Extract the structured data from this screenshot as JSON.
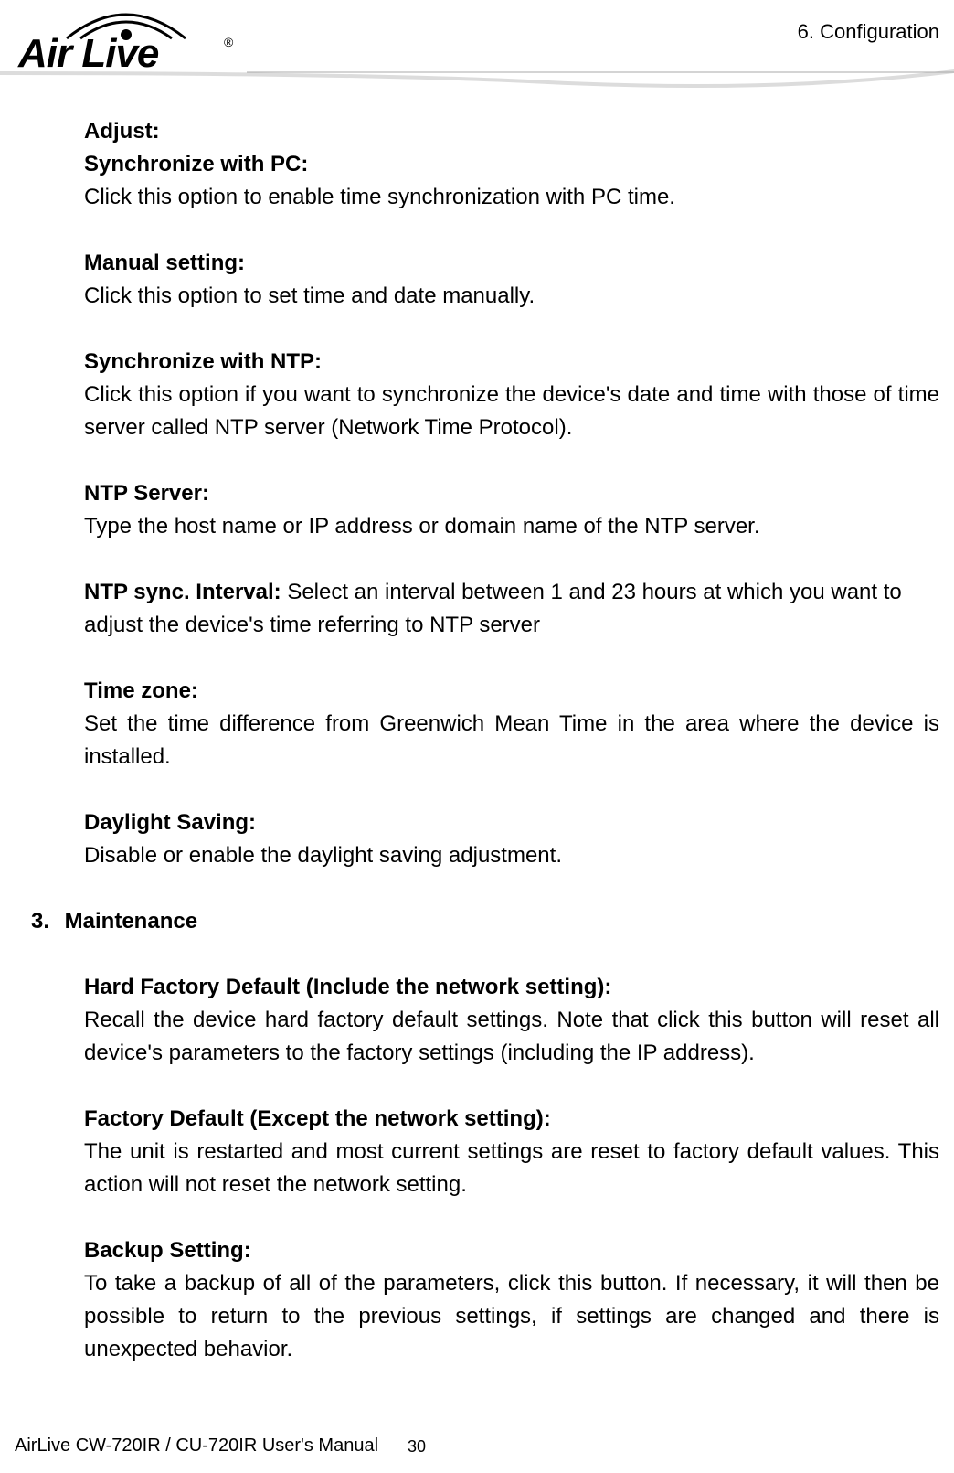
{
  "header": {
    "chapter": "6.  Configuration",
    "logo_text": "Air Live",
    "logo_reg": "®"
  },
  "body": {
    "adjust_heading": "Adjust:",
    "sync_pc_heading": "Synchronize with PC:",
    "sync_pc_text": "Click this option to enable time synchronization with PC time.",
    "manual_heading": "Manual setting:",
    "manual_text": "Click this option to set time and date manually.",
    "sync_ntp_heading": "Synchronize with NTP:",
    "sync_ntp_text": "Click this option if you want to synchronize the device's date and time with those of time server called NTP server (Network Time Protocol).",
    "ntp_server_heading": "NTP Server:",
    "ntp_server_text": "Type the host name or IP address or domain name of the NTP server.",
    "ntp_interval_heading": "NTP sync. Interval: ",
    "ntp_interval_text": "Select an interval between 1 and 23 hours at which you want to adjust the device's time referring to NTP server",
    "timezone_heading": "Time zone:",
    "timezone_text": "Set the time difference from Greenwich Mean Time in the area where the device is installed.",
    "daylight_heading": "Daylight Saving:",
    "daylight_text": "Disable or enable the daylight saving adjustment.",
    "maintenance_number": "3.",
    "maintenance_title": "Maintenance",
    "hard_factory_heading": "Hard Factory Default (Include the network setting):",
    "hard_factory_text": "Recall the device hard factory default settings. Note that click this button will reset all device's parameters to the factory settings (including the IP address).",
    "factory_heading": "Factory Default (Except the network setting):",
    "factory_text": "The unit is restarted and most current settings are reset to factory default values. This action will not reset the network setting.",
    "backup_heading": "Backup Setting:",
    "backup_text": "To take a backup of all of the parameters, click this button. If necessary, it will then be possible to return to the previous settings, if settings are changed and there is unexpected behavior."
  },
  "footer": {
    "manual_title": "AirLive CW-720IR / CU-720IR User's Manual",
    "page_number": "30"
  }
}
